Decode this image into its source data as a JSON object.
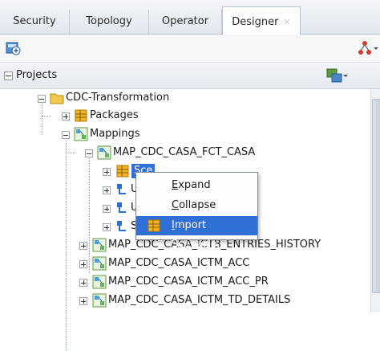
{
  "tabs": [
    {
      "label": "Security"
    },
    {
      "label": "Topology"
    },
    {
      "label": "Operator"
    },
    {
      "label": "Designer",
      "active": true
    }
  ],
  "panel": {
    "title": "Projects"
  },
  "tree": {
    "project": "CDC-Transformation",
    "packages": "Packages",
    "mappings": "Mappings",
    "map_fct": "MAP_CDC_CASA_FCT_CASA",
    "scenarios_partial": "Sce",
    "mappings_list": [
      "MAP_CDC_CASA_ICTB_ENTRIES_HISTORY",
      "MAP_CDC_CASA_ICTM_ACC",
      "MAP_CDC_CASA_ICTM_ACC_PR",
      "MAP_CDC_CASA_ICTM_TD_DETAILS"
    ],
    "child_letters": [
      "U",
      "U",
      "S"
    ]
  },
  "context_menu": {
    "items": [
      {
        "label_u": "E",
        "label_rest": "xpand"
      },
      {
        "label_u": "C",
        "label_rest": "ollapse"
      },
      {
        "label_u": "I",
        "label_rest": "mport Scenario...",
        "highlighted": true
      }
    ]
  },
  "colors": {
    "highlight": "#2f6fd6",
    "tab_bg": "#e1e6ee"
  }
}
